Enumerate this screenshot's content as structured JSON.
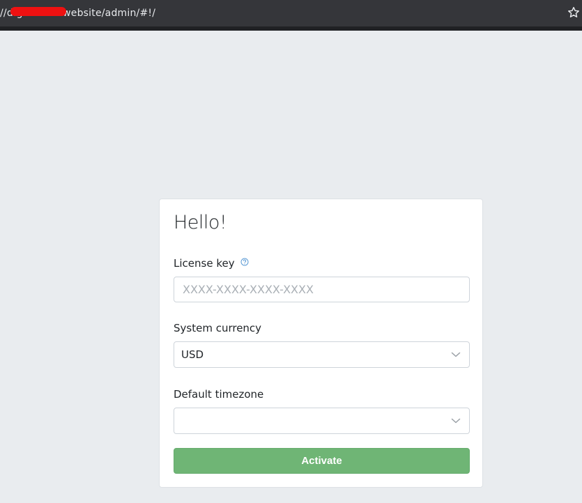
{
  "browser": {
    "url_display": "//d.gitsourcewebsite/admin/#!/",
    "bookmark_icon": "star-icon"
  },
  "card": {
    "title": "Hello!",
    "license": {
      "label": "License key",
      "help_icon": "question-circle-icon",
      "value": "",
      "placeholder": "XXXX-XXXX-XXXX-XXXX"
    },
    "currency": {
      "label": "System currency",
      "selected": "USD"
    },
    "timezone": {
      "label": "Default timezone",
      "selected": ""
    },
    "submit_label": "Activate"
  },
  "colors": {
    "page_bg": "#e9ecef",
    "button_green": "#6fb575",
    "help_icon_blue": "#5b9bd5"
  }
}
